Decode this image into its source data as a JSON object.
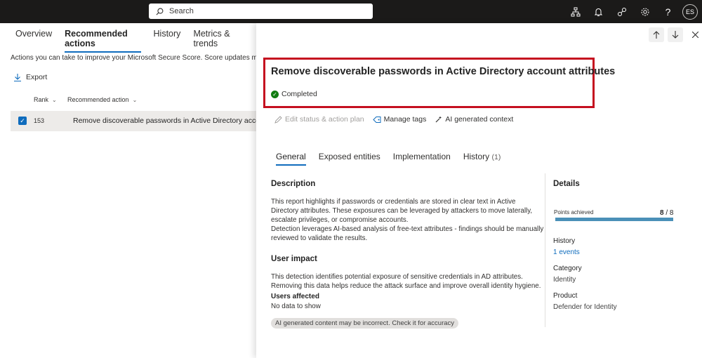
{
  "topbar": {
    "search_placeholder": "Search",
    "icons": [
      "org-chart-icon",
      "bell-icon",
      "connections-icon",
      "gear-icon",
      "help-icon"
    ],
    "avatar_initials": "ES"
  },
  "left": {
    "tabs": [
      {
        "label": "Overview",
        "active": false
      },
      {
        "label": "Recommended actions",
        "active": true
      },
      {
        "label": "History",
        "active": false
      },
      {
        "label": "Metrics & trends",
        "active": false
      }
    ],
    "intro_text": "Actions you can take to improve your Microsoft Secure Score. Score updates may take",
    "export_label": "Export",
    "columns": {
      "rank": "Rank",
      "action": "Recommended action"
    },
    "rows": [
      {
        "rank": "153",
        "action": "Remove discoverable passwords in Active Directory account"
      }
    ]
  },
  "panel": {
    "title": "Remove discoverable passwords in Active Directory account attributes",
    "status": "Completed",
    "commands": {
      "edit": "Edit status & action plan",
      "tags": "Manage tags",
      "ai": "AI generated context"
    },
    "tabs": [
      {
        "label": "General",
        "count": ""
      },
      {
        "label": "Exposed entities",
        "count": ""
      },
      {
        "label": "Implementation",
        "count": ""
      },
      {
        "label": "History",
        "count": "(1)"
      }
    ],
    "description_heading": "Description",
    "description_lines": [
      "This report highlights if passwords or credentials are stored in clear text in Active",
      "Directory attributes. These exposures can be leveraged by attackers to move laterally,",
      "escalate privileges, or compromise accounts.",
      "Detection leverages AI-based analysis of free-text attributes - findings should be manually",
      "reviewed to validate the results."
    ],
    "impact_heading": "User impact",
    "impact_lines": [
      "This detection identifies potential exposure of sensitive credentials in AD attributes.",
      "Removing this data helps reduce the attack surface and improve overall identity hygiene."
    ],
    "users_affected_label": "Users affected",
    "users_affected_value": "No data to show",
    "disclaimer": "AI generated content may be incorrect. Check it for accuracy",
    "details": {
      "heading": "Details",
      "points_label": "Points achieved",
      "points_achieved": "8",
      "points_sep": " / ",
      "points_total": "8",
      "progress_fraction": 1.0,
      "history_label": "History",
      "history_value": "1 events",
      "category_label": "Category",
      "category_value": "Identity",
      "product_label": "Product",
      "product_value": "Defender for Identity"
    }
  },
  "colors": {
    "accent": "#0f6cbd",
    "highlight": "#c50f1f",
    "success": "#107c10",
    "progress": "#4a90b8"
  }
}
